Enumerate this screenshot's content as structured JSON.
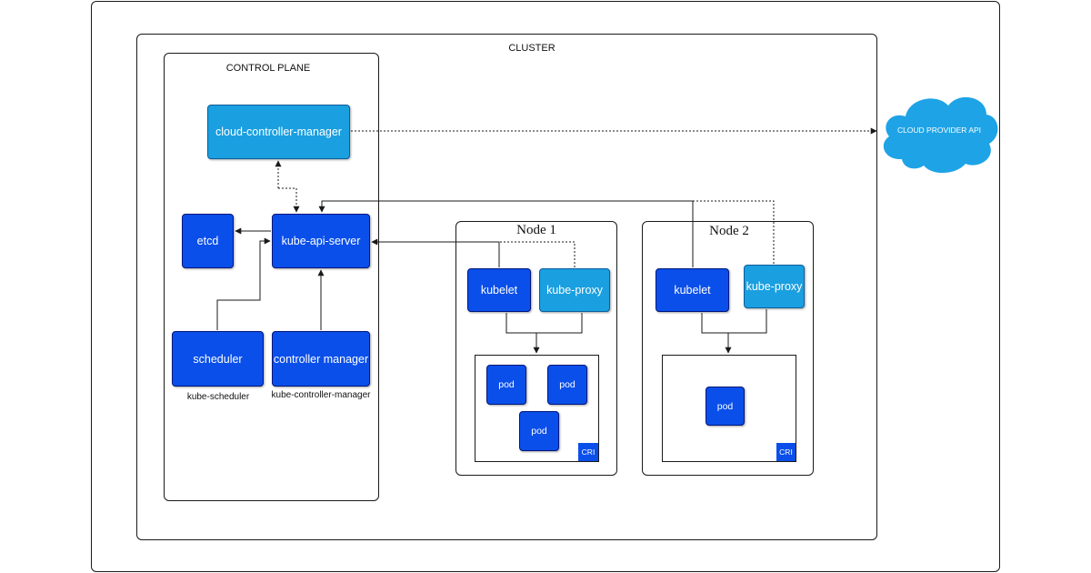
{
  "diagram": {
    "cluster_label": "CLUSTER",
    "control_plane_label": "CONTROL PLANE",
    "cloud_controller_manager": "cloud-controller-manager",
    "etcd": "etcd",
    "kube_api_server": "kube-api-server",
    "scheduler": "scheduler",
    "scheduler_caption": "kube-scheduler",
    "controller_manager": "controller manager",
    "controller_manager_caption": "kube-controller-manager",
    "cloud_provider_api": "CLOUD PROVIDER API",
    "node1": {
      "label": "Node 1",
      "kubelet": "kubelet",
      "kube_proxy": "kube-proxy",
      "pods": [
        "pod",
        "pod",
        "pod"
      ],
      "cri": "CRI"
    },
    "node2": {
      "label": "Node 2",
      "kubelet": "kubelet",
      "kube_proxy": "kube-proxy",
      "pods": [
        "pod"
      ],
      "cri": "CRI"
    }
  },
  "colors": {
    "dark_component": "#0a4fea",
    "light_component": "#1a9fe0",
    "cloud": "#1ea3e6",
    "line": "#1a1a1a"
  }
}
